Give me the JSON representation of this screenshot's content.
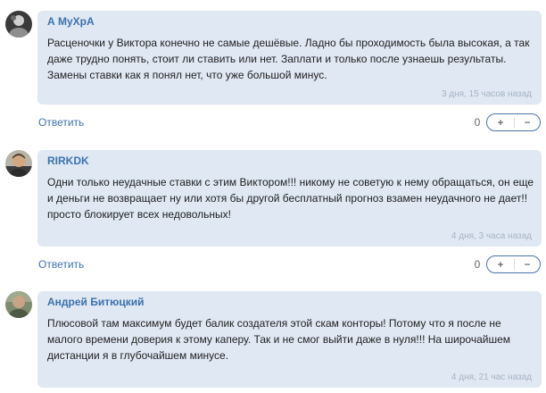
{
  "comments": [
    {
      "author": "А МуХрА",
      "text": "Расценочки у Виктора конечно не самые дешёвые. Ладно бы проходимость была высокая, а так даже трудно понять, стоит ли ставить или нет. Заплати и только после узнаешь результаты. Замены ставки как я понял нет, что уже большой минус.",
      "time": "3 дня, 15 часов назад",
      "reply_label": "Ответить",
      "votes": "0",
      "plus": "+",
      "minus": "−",
      "avatar_icon": "user-avatar-icon"
    },
    {
      "author": "RIRKDK",
      "text": "Одни только неудачные ставки с этим Виктором!!! никому не советую к нему обращаться, он еще и деньги не возвращает ну или хотя бы другой бесплатный прогноз взамен неудачного не дает!! просто блокирует всех недовольных!",
      "time": "4 дня, 3 часа назад",
      "reply_label": "Ответить",
      "votes": "0",
      "plus": "+",
      "minus": "−",
      "avatar_icon": "user-avatar-icon"
    },
    {
      "author": "Андрей Битюцкий",
      "text": "Плюсовой там максимум будет балик создателя этой скам конторы! Потому что я после не малого времени доверия к этому каперу. Так и не смог выйти даже в нуля!!! На широчайшем дистанции я в глубочайшем минусе.",
      "time": "4 дня, 21 час назад",
      "avatar_icon": "user-avatar-icon"
    }
  ],
  "colors": {
    "bubble_bg": "#dfe8f3",
    "author": "#3d72ad",
    "link": "#3d72ad",
    "text": "#222222",
    "time": "#a7b4c4",
    "vote_border": "#4a75a8"
  }
}
